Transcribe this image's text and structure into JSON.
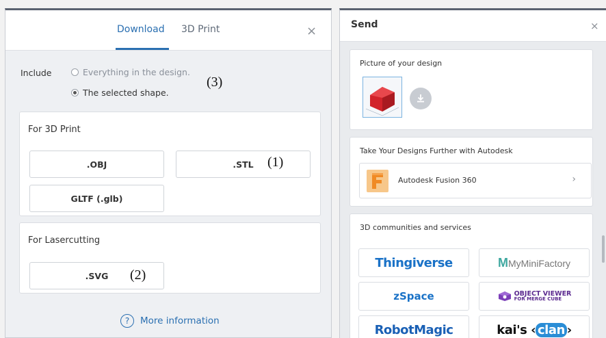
{
  "download_dialog": {
    "tabs": [
      {
        "label": "Download",
        "active": true
      },
      {
        "label": "3D Print",
        "active": false
      }
    ],
    "close_glyph": "×",
    "include_label": "Include",
    "include_options": [
      {
        "label": "Everything in the design.",
        "selected": false
      },
      {
        "label": "The selected shape.",
        "selected": true
      }
    ],
    "for_3d_print": {
      "title": "For 3D Print",
      "buttons": [
        ".OBJ",
        ".STL",
        "GLTF (.glb)"
      ]
    },
    "for_lasercutting": {
      "title": "For Lasercutting",
      "buttons": [
        ".SVG"
      ]
    },
    "more_info_label": "More information",
    "annotations": {
      "one": "(1)",
      "two": "(2)",
      "three": "(3)"
    }
  },
  "send_panel": {
    "title": "Send",
    "close_glyph": "×",
    "picture_section_title": "Picture of your design",
    "autodesk_section_title": "Take Your Designs Further with Autodesk",
    "fusion_label": "Autodesk Fusion 360",
    "communities_title": "3D communities and services",
    "services": {
      "thingiverse": "Thingiverse",
      "myminifactory_m": "M",
      "myminifactory_rest": "MyMiniFactory",
      "zspace": "zSpace",
      "objectviewer_line1": "OBJECT VIEWER",
      "objectviewer_line2": "FOR MERGE CUBE",
      "robotmagic": "RobotMagic",
      "kais": "kai's",
      "clan": "clan"
    }
  },
  "colors": {
    "accent": "#2a6fb1",
    "thingiverse": "#1a72c7",
    "shape_red": "#d2232a",
    "fusion_orange": "#f08a24"
  }
}
